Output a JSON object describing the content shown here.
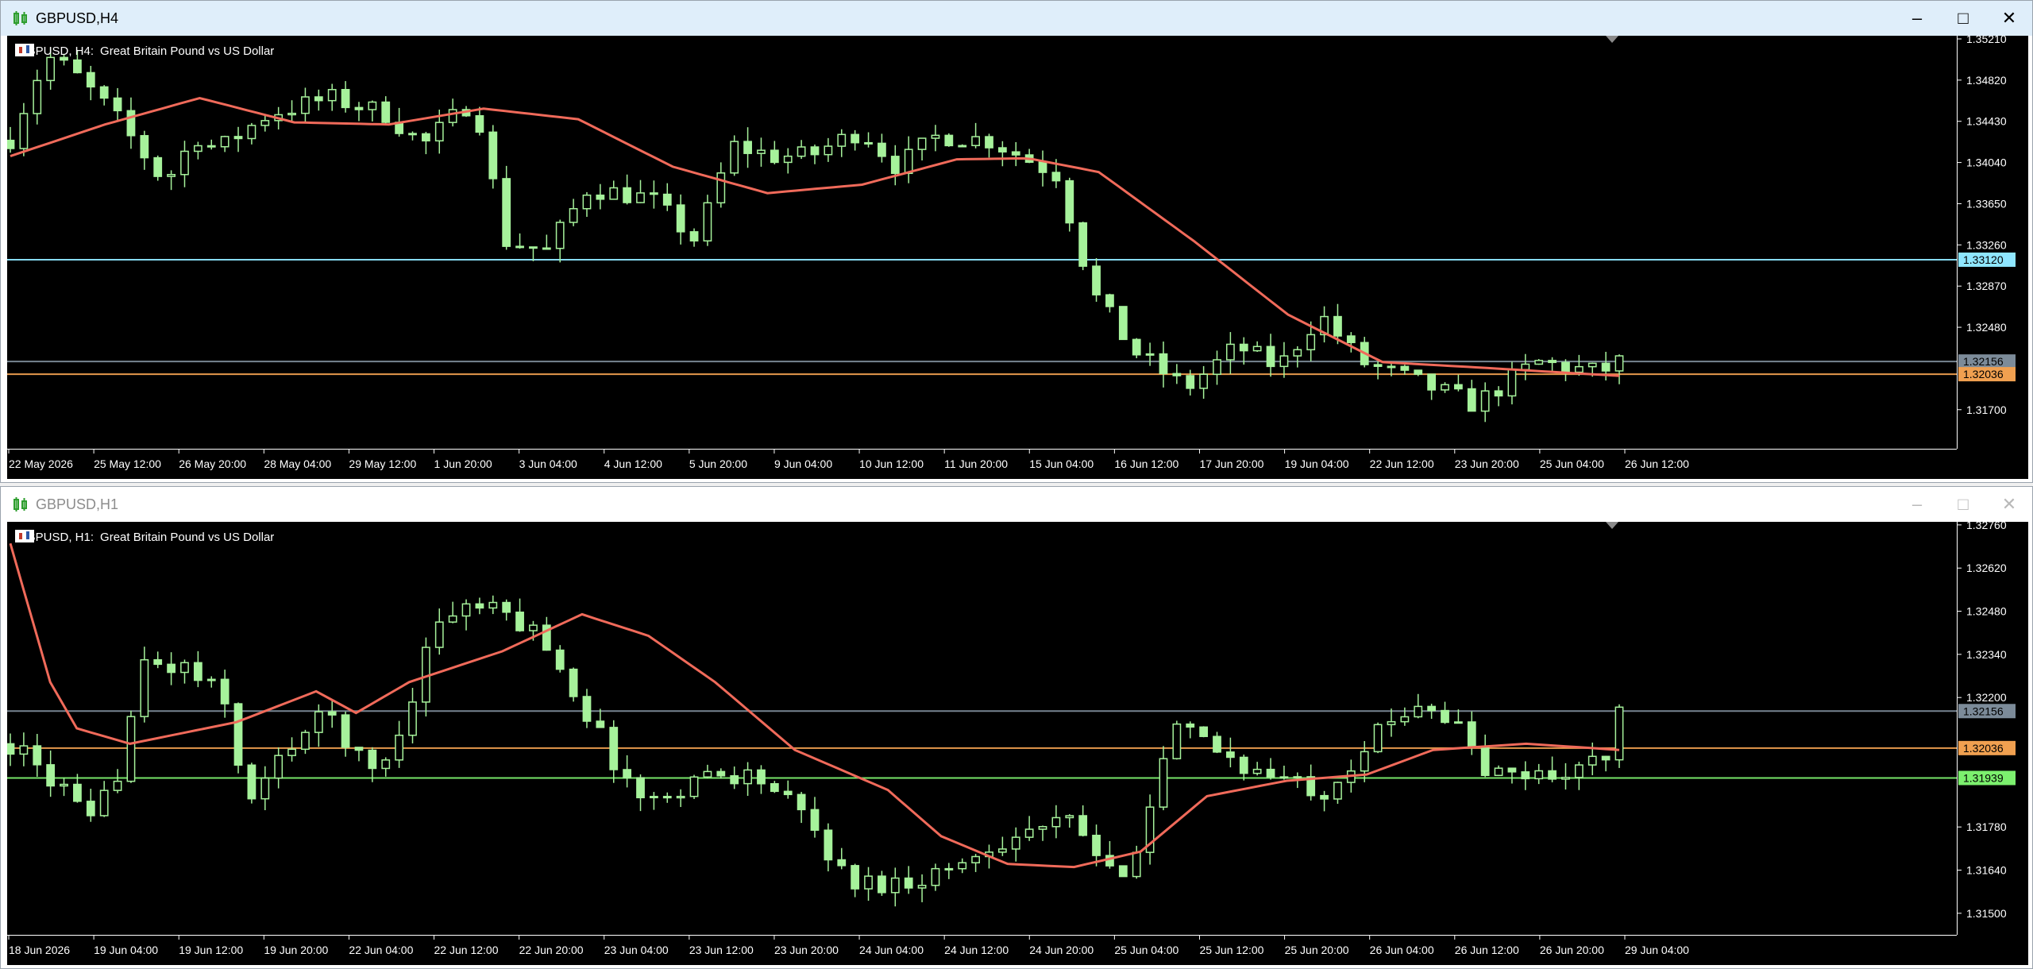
{
  "colors": {
    "up": "#a6f29b",
    "down": "#a6f29b",
    "ma": "#f06a5a",
    "bg": "#000000",
    "axis": "#ffffff",
    "bid_line": "#7c8b99",
    "ask_line": "#f0a050",
    "level_line": "#7cf06e"
  },
  "windows": [
    {
      "title": "GBPUSD,H4",
      "symbol": "GBPUSD, H4:",
      "description": "Great Britain Pound vs US Dollar",
      "buttons": {
        "minimize": "–",
        "maximize": "□",
        "close": "✕"
      },
      "price_axis": [
        "1.35210",
        "1.34820",
        "1.34430",
        "1.34040",
        "1.33650",
        "1.33260",
        "1.32870",
        "1.32480",
        "1.31700"
      ],
      "time_axis": [
        "22 May 2026",
        "25 May 12:00",
        "26 May 20:00",
        "28 May 04:00",
        "29 May 12:00",
        "1 Jun 20:00",
        "3 Jun 04:00",
        "4 Jun 12:00",
        "5 Jun 20:00",
        "9 Jun 04:00",
        "10 Jun 12:00",
        "11 Jun 20:00",
        "15 Jun 04:00",
        "16 Jun 12:00",
        "17 Jun 20:00",
        "19 Jun 04:00",
        "22 Jun 12:00",
        "23 Jun 20:00",
        "25 Jun 04:00",
        "26 Jun 12:00"
      ],
      "price_tags": [
        {
          "label": "1.33120",
          "price": 1.3312,
          "bg": "#8ee6ff",
          "fg": "#000000"
        },
        {
          "label": "1.32156",
          "price": 1.32156,
          "bg": "#7c8b99",
          "fg": "#000000"
        },
        {
          "label": "1.32036",
          "price": 1.32036,
          "bg": "#f0a050",
          "fg": "#000000"
        }
      ],
      "chart_data": {
        "type": "candlestick",
        "ymin": 1.3133,
        "ymax": 1.3524,
        "seed": 7,
        "count": 121,
        "start": 1.3425,
        "path": [
          [
            0,
            1.3427
          ],
          [
            7,
            1.3505
          ],
          [
            12,
            1.349
          ],
          [
            20,
            1.345
          ],
          [
            30,
            1.3385
          ],
          [
            36,
            1.343
          ],
          [
            40,
            1.3415
          ],
          [
            50,
            1.345
          ],
          [
            62,
            1.3465
          ],
          [
            73,
            1.345
          ],
          [
            80,
            1.342
          ],
          [
            90,
            1.3465
          ],
          [
            96,
            1.333
          ],
          [
            104,
            1.332
          ],
          [
            112,
            1.338
          ],
          [
            124,
            1.337
          ],
          [
            133,
            1.333
          ],
          [
            140,
            1.342
          ],
          [
            148,
            1.341
          ],
          [
            155,
            1.341
          ],
          [
            165,
            1.3435
          ],
          [
            172,
            1.34
          ],
          [
            180,
            1.343
          ],
          [
            190,
            1.3425
          ],
          [
            203,
            1.3393
          ],
          [
            210,
            1.328
          ],
          [
            218,
            1.3225
          ],
          [
            228,
            1.319
          ],
          [
            238,
            1.323
          ],
          [
            246,
            1.321
          ],
          [
            254,
            1.326
          ],
          [
            262,
            1.3215
          ],
          [
            276,
            1.319
          ],
          [
            284,
            1.3175
          ],
          [
            296,
            1.3215
          ],
          [
            308,
            1.3205
          ],
          [
            312,
            1.3215
          ]
        ],
        "ma_path": [
          [
            0,
            1.341
          ],
          [
            20,
            1.344
          ],
          [
            40,
            1.3465
          ],
          [
            60,
            1.3442
          ],
          [
            80,
            1.344
          ],
          [
            100,
            1.3455
          ],
          [
            120,
            1.3445
          ],
          [
            140,
            1.34
          ],
          [
            160,
            1.3375
          ],
          [
            180,
            1.3383
          ],
          [
            200,
            1.3407
          ],
          [
            215,
            1.3408
          ],
          [
            230,
            1.3395
          ],
          [
            250,
            1.333
          ],
          [
            270,
            1.326
          ],
          [
            290,
            1.3215
          ],
          [
            310,
            1.321
          ],
          [
            340,
            1.3202
          ]
        ]
      }
    },
    {
      "title": "GBPUSD,H1",
      "symbol": "GBPUSD, H1:",
      "description": "Great Britain Pound vs US Dollar",
      "buttons": {
        "minimize": "–",
        "maximize": "□",
        "close": "✕"
      },
      "price_axis": [
        "1.32760",
        "1.32620",
        "1.32480",
        "1.32340",
        "1.32200",
        "1.31780",
        "1.31640",
        "1.31500"
      ],
      "time_axis": [
        "18 Jun 2026",
        "19 Jun 04:00",
        "19 Jun 12:00",
        "19 Jun 20:00",
        "22 Jun 04:00",
        "22 Jun 12:00",
        "22 Jun 20:00",
        "23 Jun 04:00",
        "23 Jun 12:00",
        "23 Jun 20:00",
        "24 Jun 04:00",
        "24 Jun 12:00",
        "24 Jun 20:00",
        "25 Jun 04:00",
        "25 Jun 12:00",
        "25 Jun 20:00",
        "26 Jun 04:00",
        "26 Jun 12:00",
        "26 Jun 20:00",
        "29 Jun 04:00"
      ],
      "price_tags": [
        {
          "label": "1.32156",
          "price": 1.32156,
          "bg": "#7c8b99",
          "fg": "#000000"
        },
        {
          "label": "1.32036",
          "price": 1.32036,
          "bg": "#f0a050",
          "fg": "#000000"
        },
        {
          "label": "1.31939",
          "price": 1.31939,
          "bg": "#7cf06e",
          "fg": "#000000"
        }
      ],
      "chart_data": {
        "type": "candlestick",
        "ymin": 1.3143,
        "ymax": 1.3277,
        "seed": 13,
        "count": 121,
        "start": 1.3205,
        "path": [
          [
            0,
            1.3205
          ],
          [
            8,
            1.319
          ],
          [
            12,
            1.3178
          ],
          [
            16,
            1.3195
          ],
          [
            20,
            1.323
          ],
          [
            26,
            1.323
          ],
          [
            32,
            1.322
          ],
          [
            36,
            1.3185
          ],
          [
            42,
            1.3205
          ],
          [
            48,
            1.3215
          ],
          [
            54,
            1.3195
          ],
          [
            58,
            1.3205
          ],
          [
            64,
            1.3245
          ],
          [
            70,
            1.325
          ],
          [
            76,
            1.3245
          ],
          [
            80,
            1.324
          ],
          [
            88,
            1.321
          ],
          [
            92,
            1.3195
          ],
          [
            96,
            1.3185
          ],
          [
            104,
            1.3195
          ],
          [
            112,
            1.3195
          ],
          [
            120,
            1.318
          ],
          [
            126,
            1.316
          ],
          [
            134,
            1.316
          ],
          [
            142,
            1.3165
          ],
          [
            150,
            1.3175
          ],
          [
            160,
            1.318
          ],
          [
            166,
            1.316
          ],
          [
            170,
            1.3175
          ],
          [
            175,
            1.321
          ],
          [
            180,
            1.3205
          ],
          [
            188,
            1.3195
          ],
          [
            198,
            1.319
          ],
          [
            204,
            1.3205
          ],
          [
            212,
            1.322
          ],
          [
            218,
            1.321
          ],
          [
            222,
            1.3195
          ],
          [
            232,
            1.3195
          ],
          [
            240,
            1.32
          ],
          [
            242,
            1.3215
          ]
        ],
        "ma_path": [
          [
            0,
            1.327
          ],
          [
            6,
            1.3225
          ],
          [
            10,
            1.321
          ],
          [
            18,
            1.3205
          ],
          [
            34,
            1.3212
          ],
          [
            46,
            1.3222
          ],
          [
            52,
            1.3215
          ],
          [
            60,
            1.3225
          ],
          [
            74,
            1.3235
          ],
          [
            86,
            1.3247
          ],
          [
            96,
            1.324
          ],
          [
            106,
            1.3225
          ],
          [
            118,
            1.3203
          ],
          [
            132,
            1.319
          ],
          [
            140,
            1.3175
          ],
          [
            150,
            1.3166
          ],
          [
            160,
            1.3165
          ],
          [
            170,
            1.317
          ],
          [
            180,
            1.3188
          ],
          [
            192,
            1.3193
          ],
          [
            204,
            1.3195
          ],
          [
            214,
            1.3203
          ],
          [
            228,
            1.3205
          ],
          [
            242,
            1.3203
          ]
        ]
      }
    }
  ]
}
